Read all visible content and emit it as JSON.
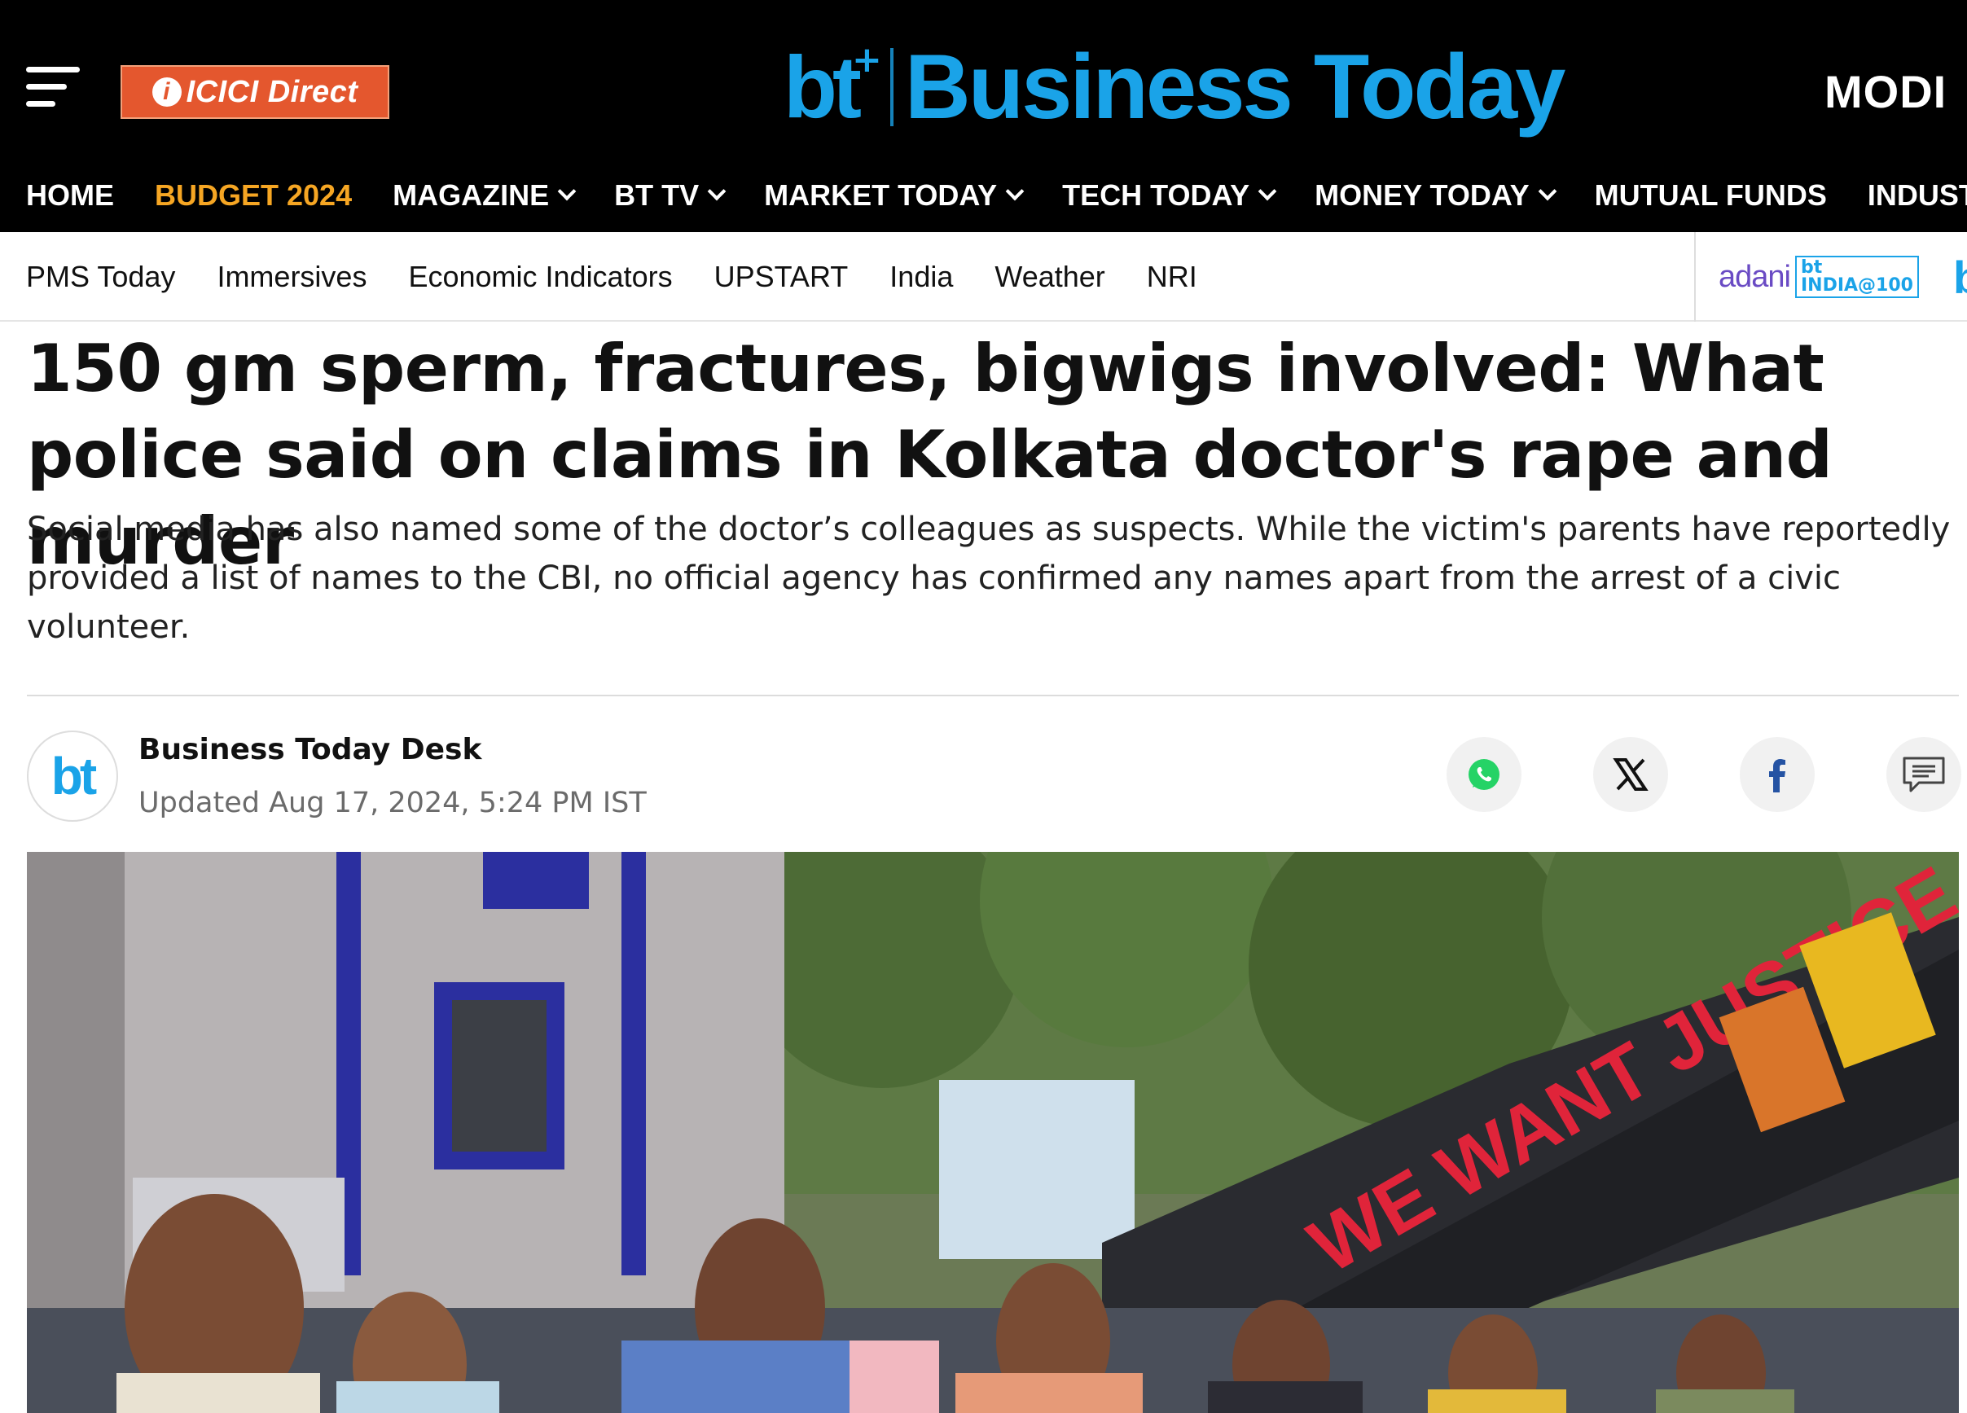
{
  "header": {
    "sponsor": "ICICI Direct",
    "brand_mark": "bt",
    "brand_name": "Business Today",
    "right_logo": "MODI"
  },
  "main_nav": [
    {
      "label": "HOME",
      "dropdown": false
    },
    {
      "label": "BUDGET 2024",
      "dropdown": false,
      "accent": true
    },
    {
      "label": "MAGAZINE",
      "dropdown": true
    },
    {
      "label": "BT TV",
      "dropdown": true
    },
    {
      "label": "MARKET TODAY",
      "dropdown": true
    },
    {
      "label": "TECH TODAY",
      "dropdown": true
    },
    {
      "label": "MONEY TODAY",
      "dropdown": true
    },
    {
      "label": "MUTUAL FUNDS",
      "dropdown": false
    },
    {
      "label": "INDUSTRY",
      "dropdown": true
    }
  ],
  "sub_nav": [
    "PMS Today",
    "Immersives",
    "Economic Indicators",
    "UPSTART",
    "India",
    "Weather",
    "NRI"
  ],
  "partner": {
    "adani": "adani",
    "badge": "bt INDIA@100",
    "bt": "bt"
  },
  "article": {
    "headline": "150 gm sperm, fractures, bigwigs involved: What police said on claims in Kolkata doctor's rape and murder",
    "standfirst": "Social media has also named some of the doctor’s colleagues as suspects. While the victim's parents have reportedly provided a list of names to the CBI, no official agency has confirmed any names apart from the arrest of a civic volunteer.",
    "author": "Business Today Desk",
    "author_avatar": "bt",
    "updated": "Updated Aug 17, 2024, 5:24 PM IST",
    "banner_text": "WE WANT JUSTICE"
  },
  "share_icons": [
    "whatsapp-icon",
    "x-icon",
    "facebook-icon",
    "comment-icon"
  ],
  "colors": {
    "brand_blue": "#1aa3e8",
    "nav_accent": "#f6a623",
    "header_bg": "#000000",
    "sponsor_bg": "#e4572e"
  }
}
